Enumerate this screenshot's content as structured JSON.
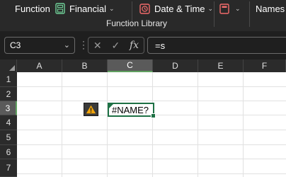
{
  "ribbon": {
    "function_label": "Function",
    "financial_label": "Financial",
    "datetime_label": "Date & Time",
    "names_label": "Names",
    "group_label": "Function Library"
  },
  "formula_bar": {
    "name_box_value": "C3",
    "formula_value": "=s",
    "fx_label": "fx"
  },
  "columns": [
    "A",
    "B",
    "C",
    "D",
    "E",
    "F"
  ],
  "rows": [
    "1",
    "2",
    "3",
    "4",
    "5",
    "6",
    "7"
  ],
  "active_cell": {
    "column": "C",
    "row": "3",
    "value": "#NAME?"
  },
  "colors": {
    "accent_green": "#1e7145",
    "warning": "#f0a30a"
  }
}
